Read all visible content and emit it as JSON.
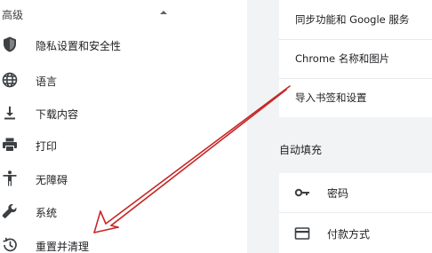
{
  "sidebar": {
    "advanced_label": "高级",
    "items": [
      {
        "label": "隐私设置和安全性",
        "icon": "shield-icon"
      },
      {
        "label": "语言",
        "icon": "globe-icon"
      },
      {
        "label": "下载内容",
        "icon": "download-icon"
      },
      {
        "label": "打印",
        "icon": "printer-icon"
      },
      {
        "label": "无障碍",
        "icon": "accessibility-icon"
      },
      {
        "label": "系统",
        "icon": "wrench-icon"
      },
      {
        "label": "重置并清理",
        "icon": "restore-icon"
      }
    ]
  },
  "main": {
    "sync_card": {
      "rows": [
        {
          "label": "同步功能和 Google 服务"
        },
        {
          "label": "Chrome 名称和图片"
        },
        {
          "label": "导入书签和设置"
        }
      ]
    },
    "autofill": {
      "section_title": "自动填充",
      "rows": [
        {
          "label": "密码",
          "icon": "key-icon"
        },
        {
          "label": "付款方式",
          "icon": "credit-card-icon"
        }
      ]
    }
  },
  "colors": {
    "icon": "#3c4043",
    "sidebar_bg": "#ffffff",
    "main_bg": "#f1f3f4",
    "annotation_arrow": "#c62828"
  }
}
